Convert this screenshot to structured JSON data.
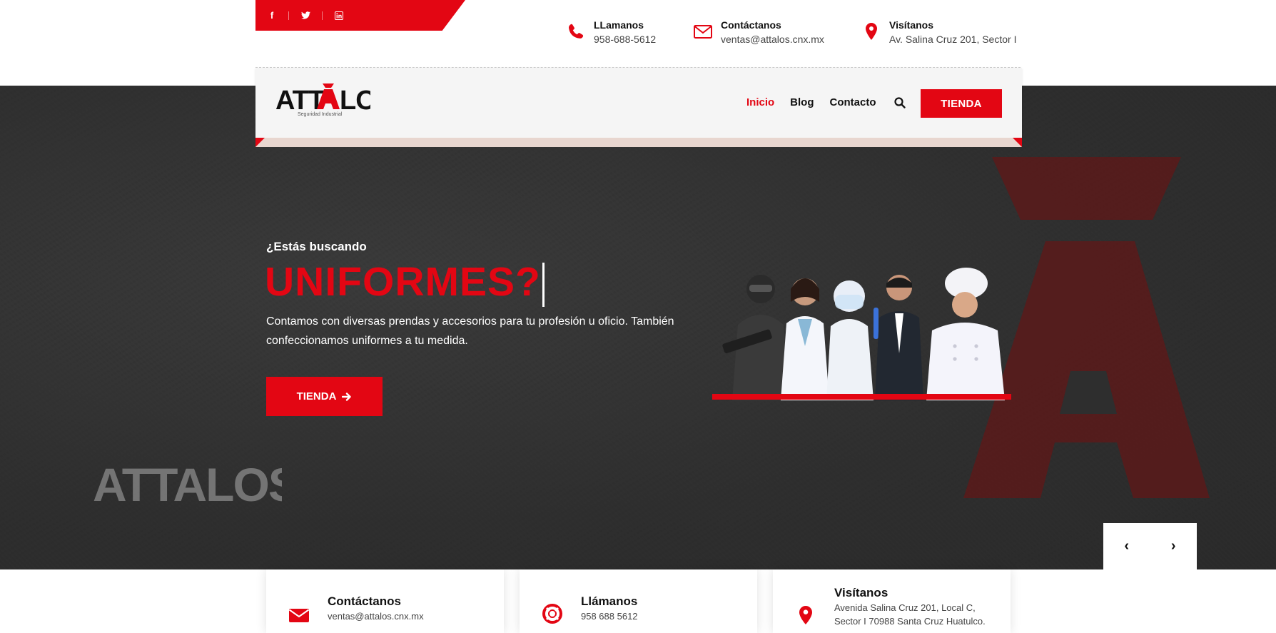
{
  "topbar": {
    "social": [
      {
        "name": "facebook-icon",
        "glyph": "f"
      },
      {
        "name": "twitter-icon",
        "glyph": "t"
      },
      {
        "name": "linkedin-icon",
        "glyph": "in"
      }
    ],
    "call_title": "LLamanos",
    "call_value": "958-688-5612",
    "mail_title": "Contáctanos",
    "mail_value": "ventas@attalos.cnx.mx",
    "visit_title": "Visítanos",
    "visit_value": "Av. Salina Cruz 201, Sector I"
  },
  "nav": {
    "logo_text": "ATTALOS",
    "logo_sub": "Seguridad Industrial",
    "items": [
      {
        "label": "Inicio",
        "active": true
      },
      {
        "label": "Blog",
        "active": false
      },
      {
        "label": "Contacto",
        "active": false
      }
    ],
    "shop_label": "TIENDA"
  },
  "hero": {
    "eyebrow": "¿Estás buscando",
    "headline": "UNIFORMES?",
    "description": "Contamos con diversas prendas y accesorios para tu profesión u oficio. También confeccionamos uniformes a tu medida.",
    "button_label": "TIENDA",
    "watermark": "ATTALOS"
  },
  "slider": {
    "prev": "‹",
    "next": "›"
  },
  "cards": [
    {
      "title": "Contáctanos",
      "value": "ventas@attalos.cnx.mx",
      "icon": "envelope-icon"
    },
    {
      "title": "Llámanos",
      "value": "958 688 5612",
      "icon": "lifebuoy-icon"
    },
    {
      "title": "Visítanos",
      "value": "Avenida Salina Cruz 201, Local C, Sector I 70988 Santa Cruz Huatulco.",
      "icon": "map-pin-icon"
    }
  ],
  "colors": {
    "brand_red": "#e30613",
    "hero_bg": "#333333"
  }
}
